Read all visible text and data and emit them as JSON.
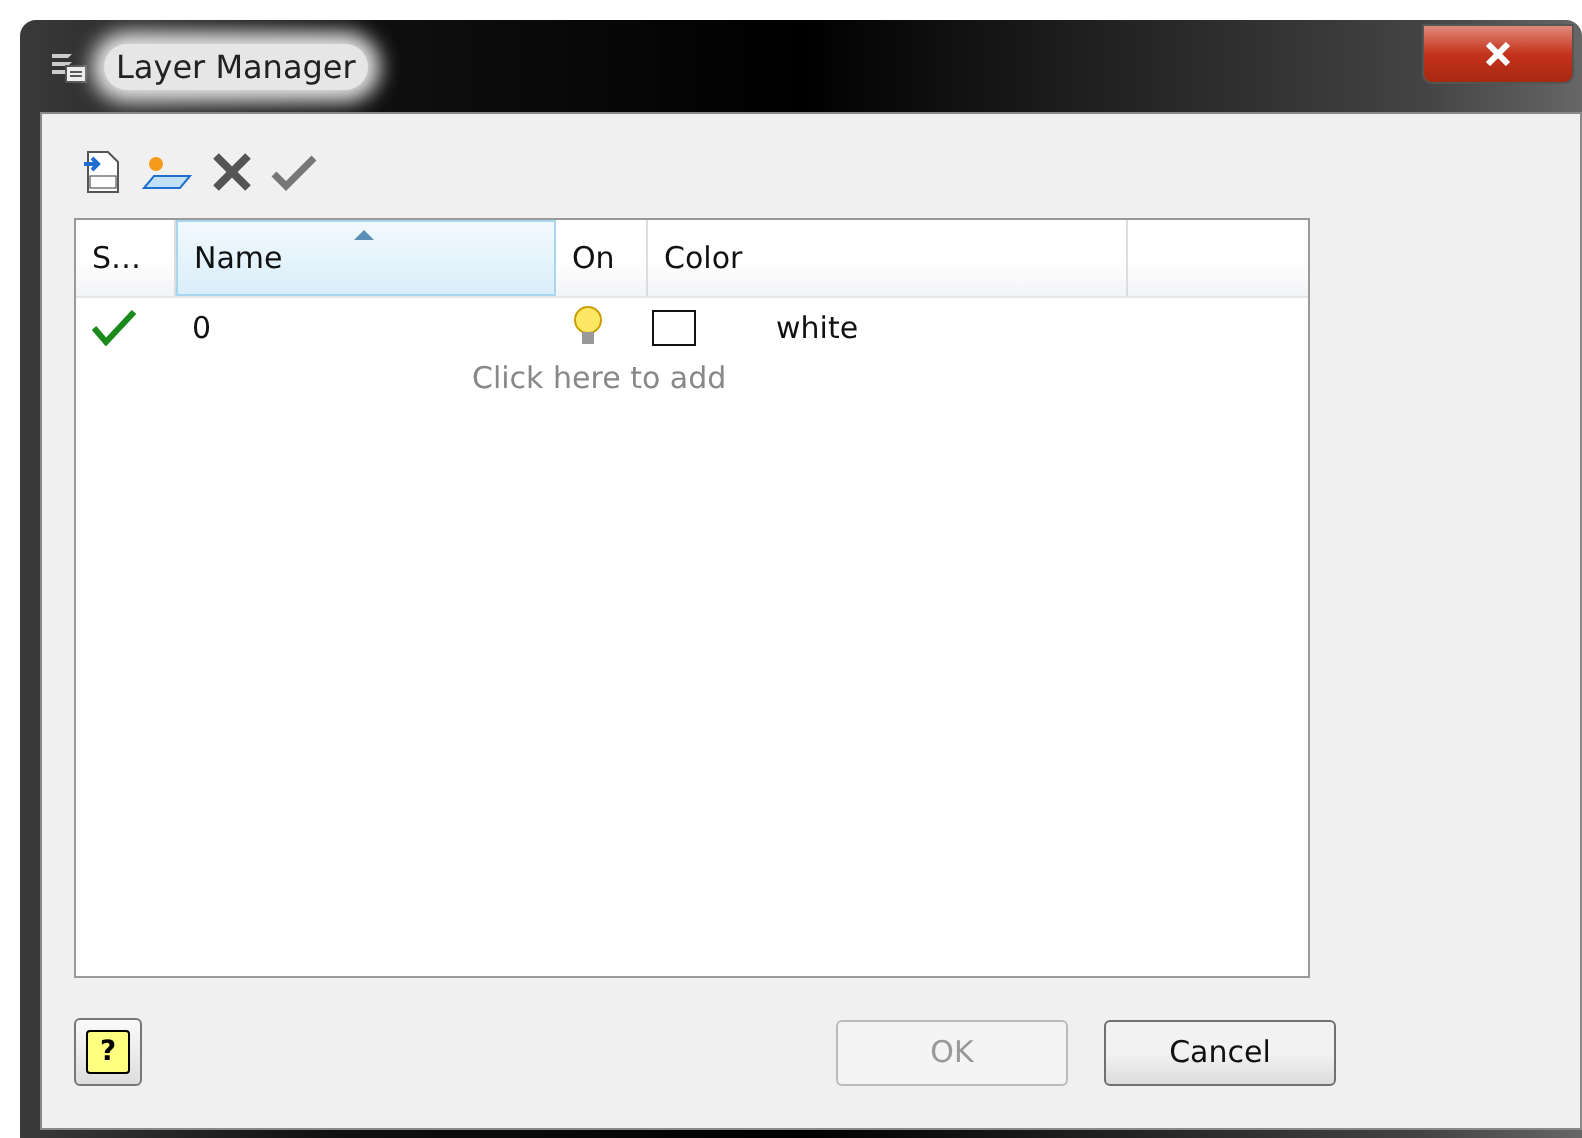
{
  "window": {
    "title": "Layer Manager"
  },
  "table": {
    "columns": [
      {
        "label": "S…",
        "sorted": false
      },
      {
        "label": "Name",
        "sorted": true
      },
      {
        "label": "On",
        "sorted": false
      },
      {
        "label": "Color",
        "sorted": false
      }
    ],
    "rows": [
      {
        "current": true,
        "name": "0",
        "on": true,
        "color": "#ffffff",
        "color_name": "white"
      }
    ],
    "add_hint": "Click here to add"
  },
  "help_button": {
    "label": "?"
  },
  "buttons": [
    {
      "label": "OK",
      "disabled": true
    },
    {
      "label": "Cancel",
      "disabled": false
    }
  ]
}
